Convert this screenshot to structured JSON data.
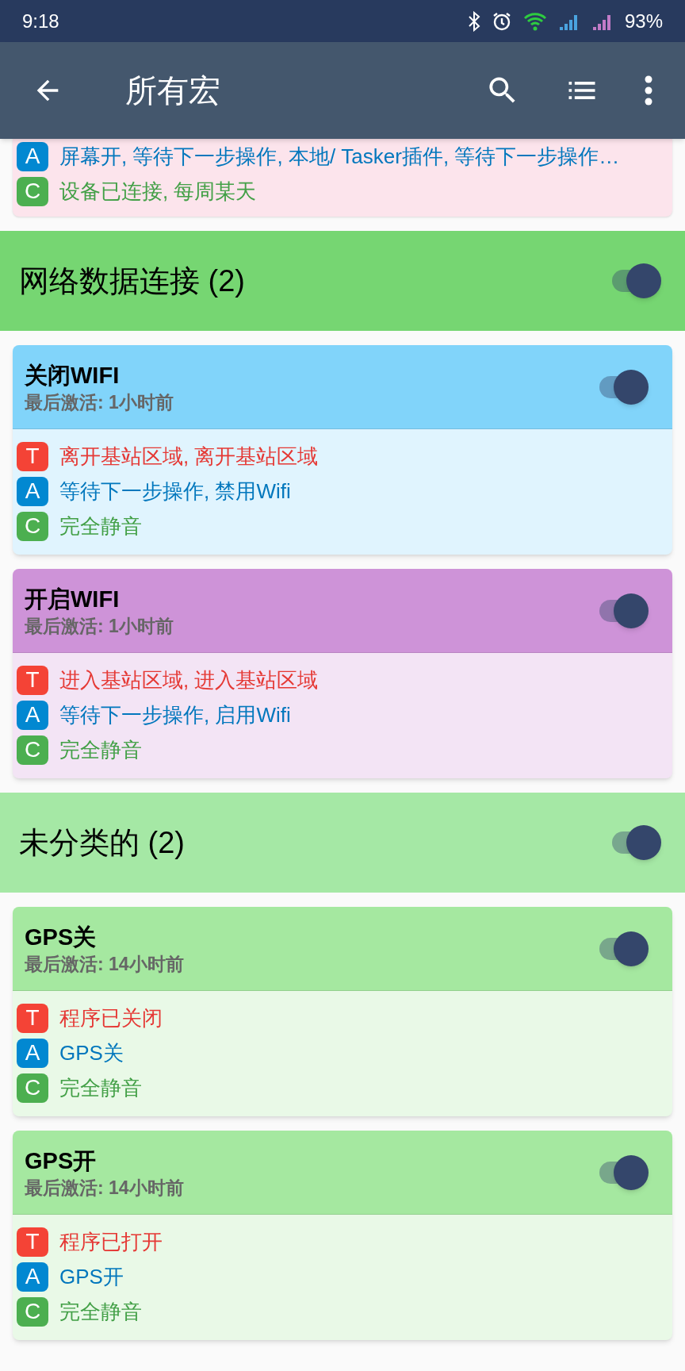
{
  "status_bar": {
    "time": "9:18",
    "battery": "93%"
  },
  "app_bar": {
    "title": "所有宏"
  },
  "partial_card": {
    "color": "#fce4ec",
    "lines": [
      {
        "kind": "A",
        "text": "屏幕开, 等待下一步操作, 本地/ Tasker插件, 等待下一步操作…"
      },
      {
        "kind": "C",
        "text": "设备已连接, 每周某天"
      }
    ]
  },
  "groups": [
    {
      "title": "网络数据连接 (2)",
      "on": true,
      "color": "#76d672",
      "macros": [
        {
          "name": "关闭WIFI",
          "last_active": "最后激活: 1小时前",
          "on": true,
          "color": "#81d4fa",
          "lines": [
            {
              "kind": "T",
              "text": "离开基站区域, 离开基站区域"
            },
            {
              "kind": "A",
              "text": "等待下一步操作, 禁用Wifi"
            },
            {
              "kind": "C",
              "text": "完全静音"
            }
          ]
        },
        {
          "name": "开启WIFI",
          "last_active": "最后激活: 1小时前",
          "on": true,
          "color": "#ce93d8",
          "lines": [
            {
              "kind": "T",
              "text": "进入基站区域, 进入基站区域"
            },
            {
              "kind": "A",
              "text": "等待下一步操作, 启用Wifi"
            },
            {
              "kind": "C",
              "text": "完全静音"
            }
          ]
        }
      ]
    },
    {
      "title": "未分类的 (2)",
      "on": true,
      "color": "#a5e8a5",
      "macros": [
        {
          "name": "GPS关",
          "last_active": "最后激活: 14小时前",
          "on": true,
          "color": "#a5e8a0",
          "lines": [
            {
              "kind": "T",
              "text": "程序已关闭"
            },
            {
              "kind": "A",
              "text": "GPS关"
            },
            {
              "kind": "C",
              "text": "完全静音"
            }
          ]
        },
        {
          "name": "GPS开",
          "last_active": "最后激活: 14小时前",
          "on": true,
          "color": "#a5e8a0",
          "lines": [
            {
              "kind": "T",
              "text": "程序已打开"
            },
            {
              "kind": "A",
              "text": "GPS开"
            },
            {
              "kind": "C",
              "text": "完全静音"
            }
          ]
        }
      ]
    }
  ]
}
